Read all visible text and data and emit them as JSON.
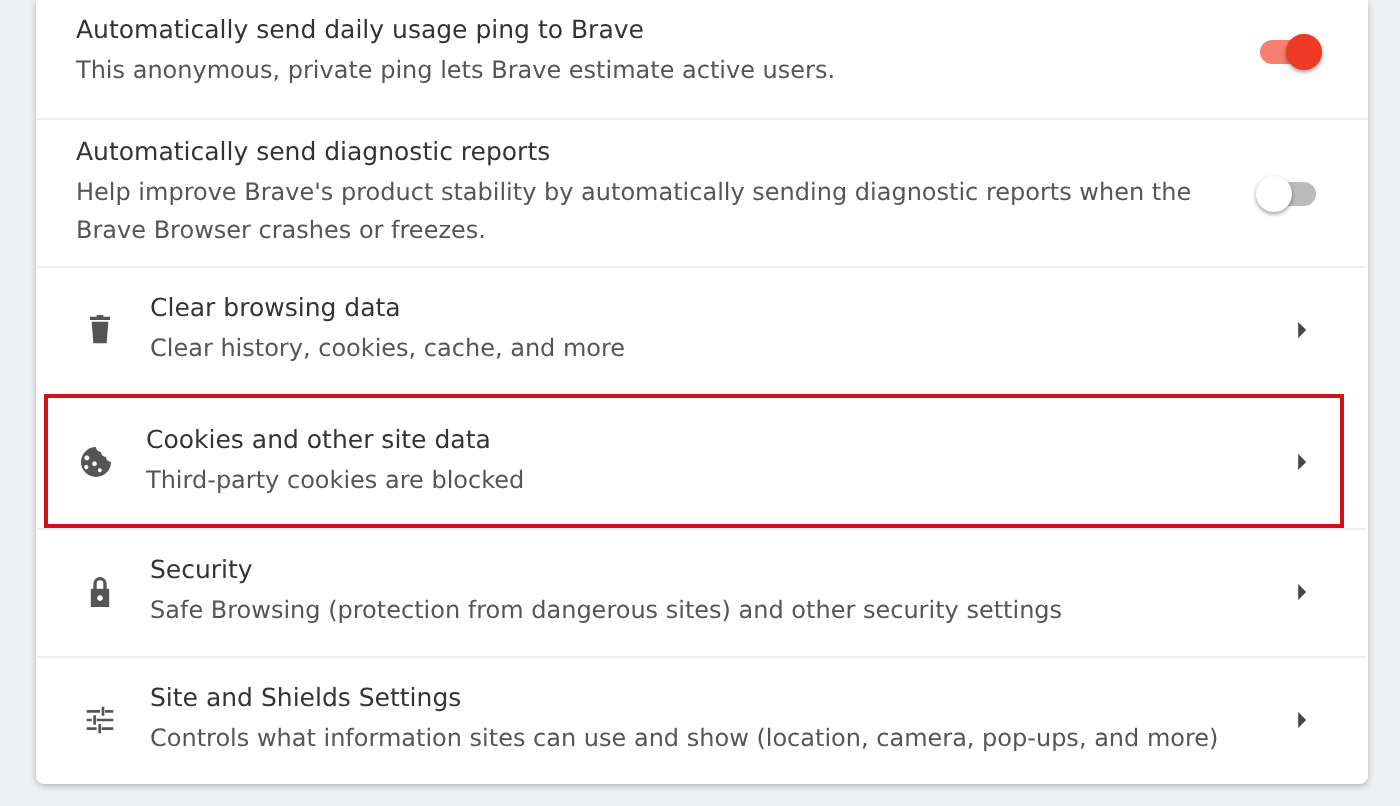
{
  "rows": [
    {
      "kind": "toggle",
      "title": "Automatically send daily usage ping to Brave",
      "subtitle": "This anonymous, private ping lets Brave estimate active users.",
      "on": true
    },
    {
      "kind": "toggle",
      "title": "Automatically send diagnostic reports",
      "subtitle": "Help improve Brave's product stability by automatically sending diagnostic reports when the Brave Browser crashes or freezes.",
      "on": false
    },
    {
      "kind": "link",
      "title": "Clear browsing data",
      "subtitle": "Clear history, cookies, cache, and more",
      "highlighted": false
    },
    {
      "kind": "link",
      "title": "Cookies and other site data",
      "subtitle": "Third-party cookies are blocked",
      "highlighted": true
    },
    {
      "kind": "link",
      "title": "Security",
      "subtitle": "Safe Browsing (protection from dangerous sites) and other security settings",
      "highlighted": false
    },
    {
      "kind": "link",
      "title": "Site and Shields Settings",
      "subtitle": "Controls what information sites can use and show (location, camera, pop-ups, and more)",
      "highlighted": false
    }
  ]
}
